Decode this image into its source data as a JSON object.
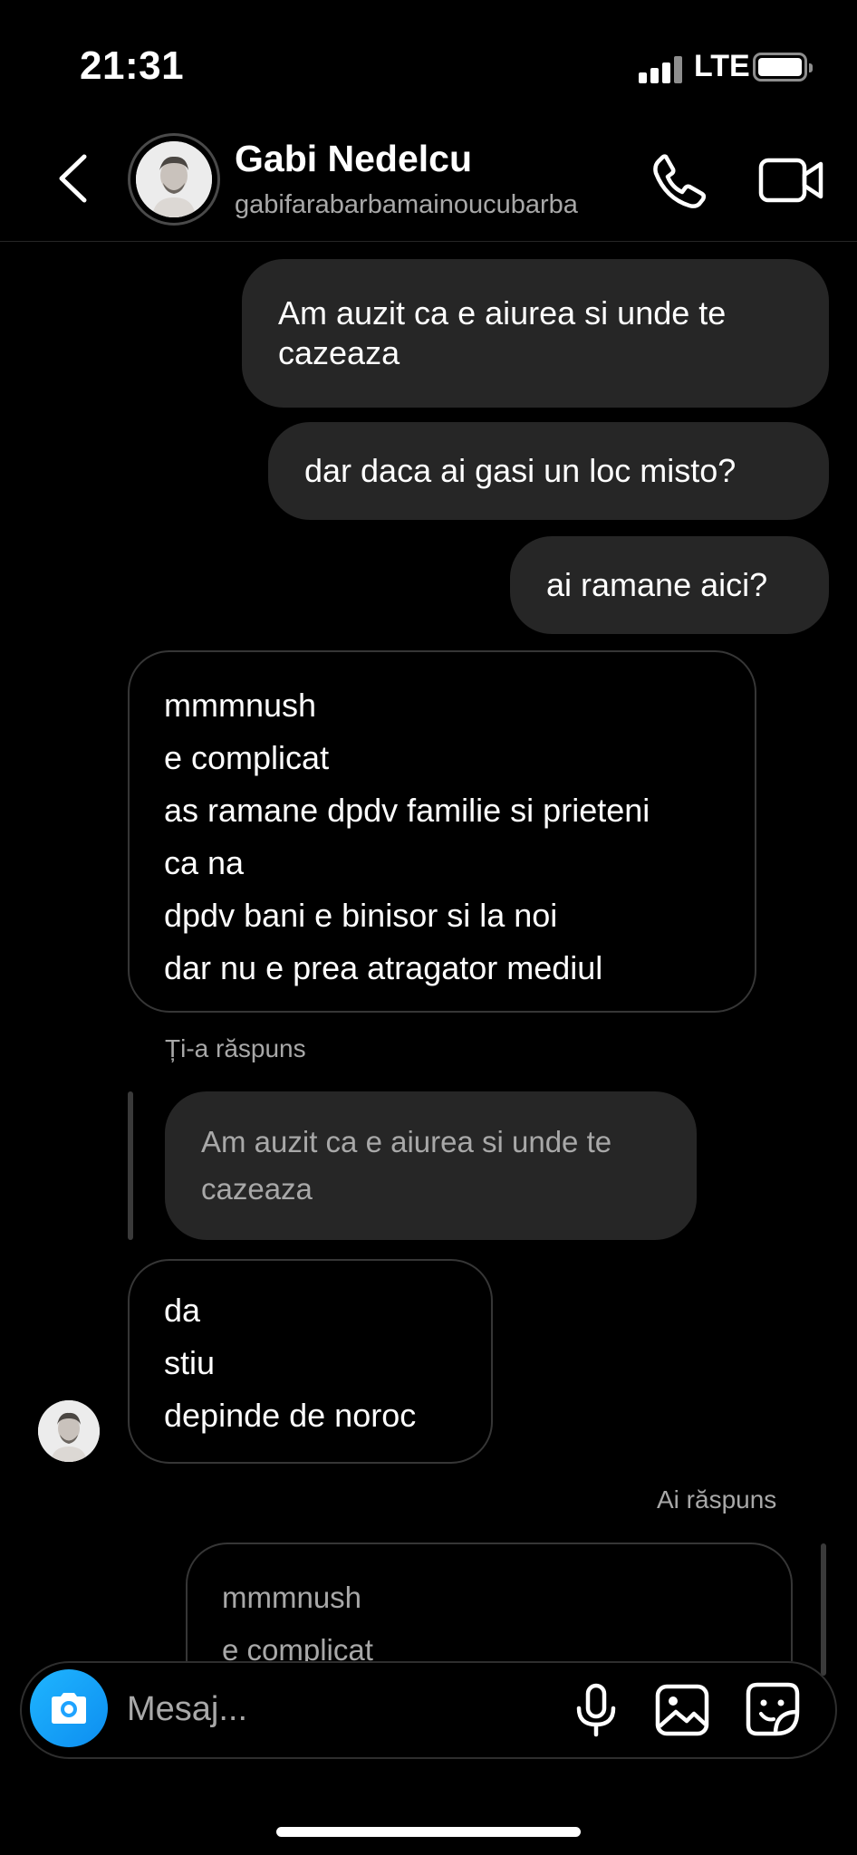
{
  "status_bar": {
    "time": "21:31",
    "network": "LTE"
  },
  "header": {
    "name": "Gabi Nedelcu",
    "handle": "gabifarabarbamainoucubarba",
    "icons": {
      "back": "chevron-left-icon",
      "call": "phone-icon",
      "video": "video-camera-icon"
    }
  },
  "messages": {
    "sent_1": [
      "Am auzit ca e aiurea si unde te",
      "cazeaza"
    ],
    "sent_2": [
      "dar daca ai gasi un loc misto?"
    ],
    "sent_3": [
      "ai ramane aici?"
    ],
    "recv_1": [
      "mmmnush",
      "e complicat",
      "as ramane dpdv familie si prieteni",
      "ca na",
      "dpdv bani e binisor si la noi",
      "dar nu e prea atragator mediul"
    ],
    "reply_meta_1": "Ți-a răspuns",
    "quoted_1": [
      "Am auzit ca e aiurea si unde te",
      "cazeaza"
    ],
    "recv_2": [
      "da",
      "stiu",
      "depinde de noroc"
    ],
    "reply_meta_2": "Ai răspuns",
    "quoted_2": [
      "mmmnush",
      "e complicat"
    ]
  },
  "composer": {
    "placeholder": "Mesaj...",
    "icons": {
      "camera": "camera-icon",
      "mic": "microphone-icon",
      "gallery": "image-icon",
      "sticker": "sticker-icon"
    }
  },
  "colors": {
    "background": "#000000",
    "bubble_sent": "#262626",
    "muted_text": "#a8a8a8",
    "camera_accent": "#1fa3ff"
  }
}
